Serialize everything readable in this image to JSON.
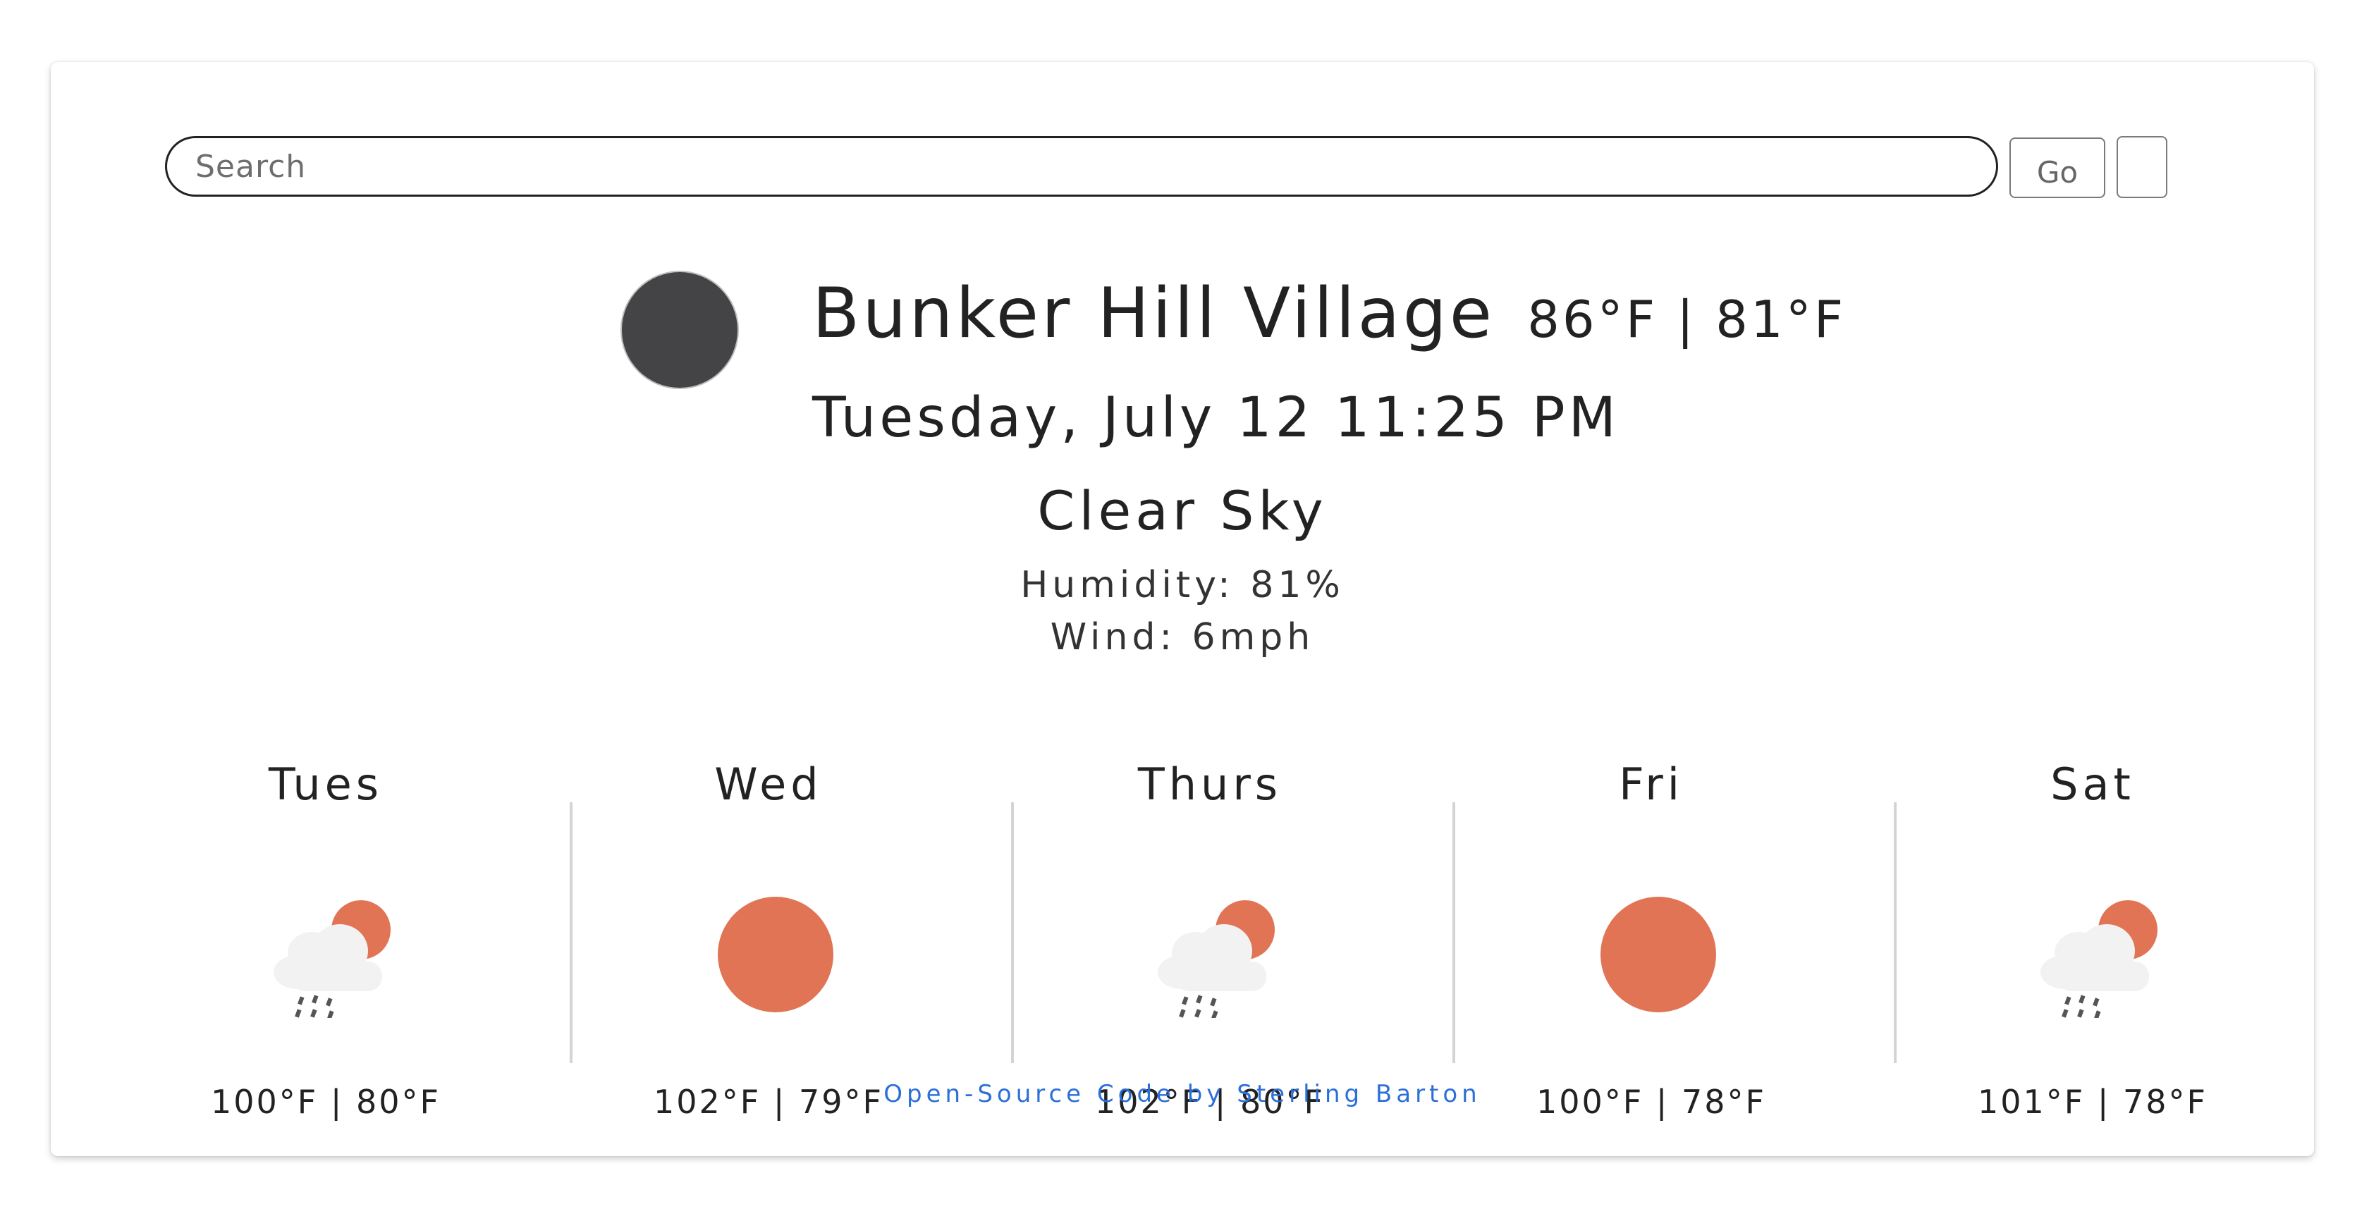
{
  "search": {
    "placeholder": "Search",
    "go_label": "Go"
  },
  "current": {
    "icon": "moon-icon",
    "city": "Bunker Hill Village",
    "temps": "86°F | 81°F",
    "datetime": "Tuesday, July 12 11:25 PM",
    "condition": "Clear Sky",
    "humidity": "Humidity: 81%",
    "wind": "Wind: 6mph"
  },
  "forecast": [
    {
      "day": "Tues",
      "icon": "rain-sun-cloud-icon",
      "temps": "100°F | 80°F"
    },
    {
      "day": "Wed",
      "icon": "sun-icon",
      "temps": "102°F | 79°F"
    },
    {
      "day": "Thurs",
      "icon": "rain-sun-cloud-icon",
      "temps": "102°F | 80°F"
    },
    {
      "day": "Fri",
      "icon": "sun-icon",
      "temps": "100°F | 78°F"
    },
    {
      "day": "Sat",
      "icon": "rain-sun-cloud-icon",
      "temps": "101°F | 78°F"
    }
  ],
  "footer": {
    "link_text": "Open-Source Code by Sterling Barton"
  },
  "colors": {
    "sun": "#e07455",
    "moon": "#444446",
    "link": "#2b6fd8"
  }
}
